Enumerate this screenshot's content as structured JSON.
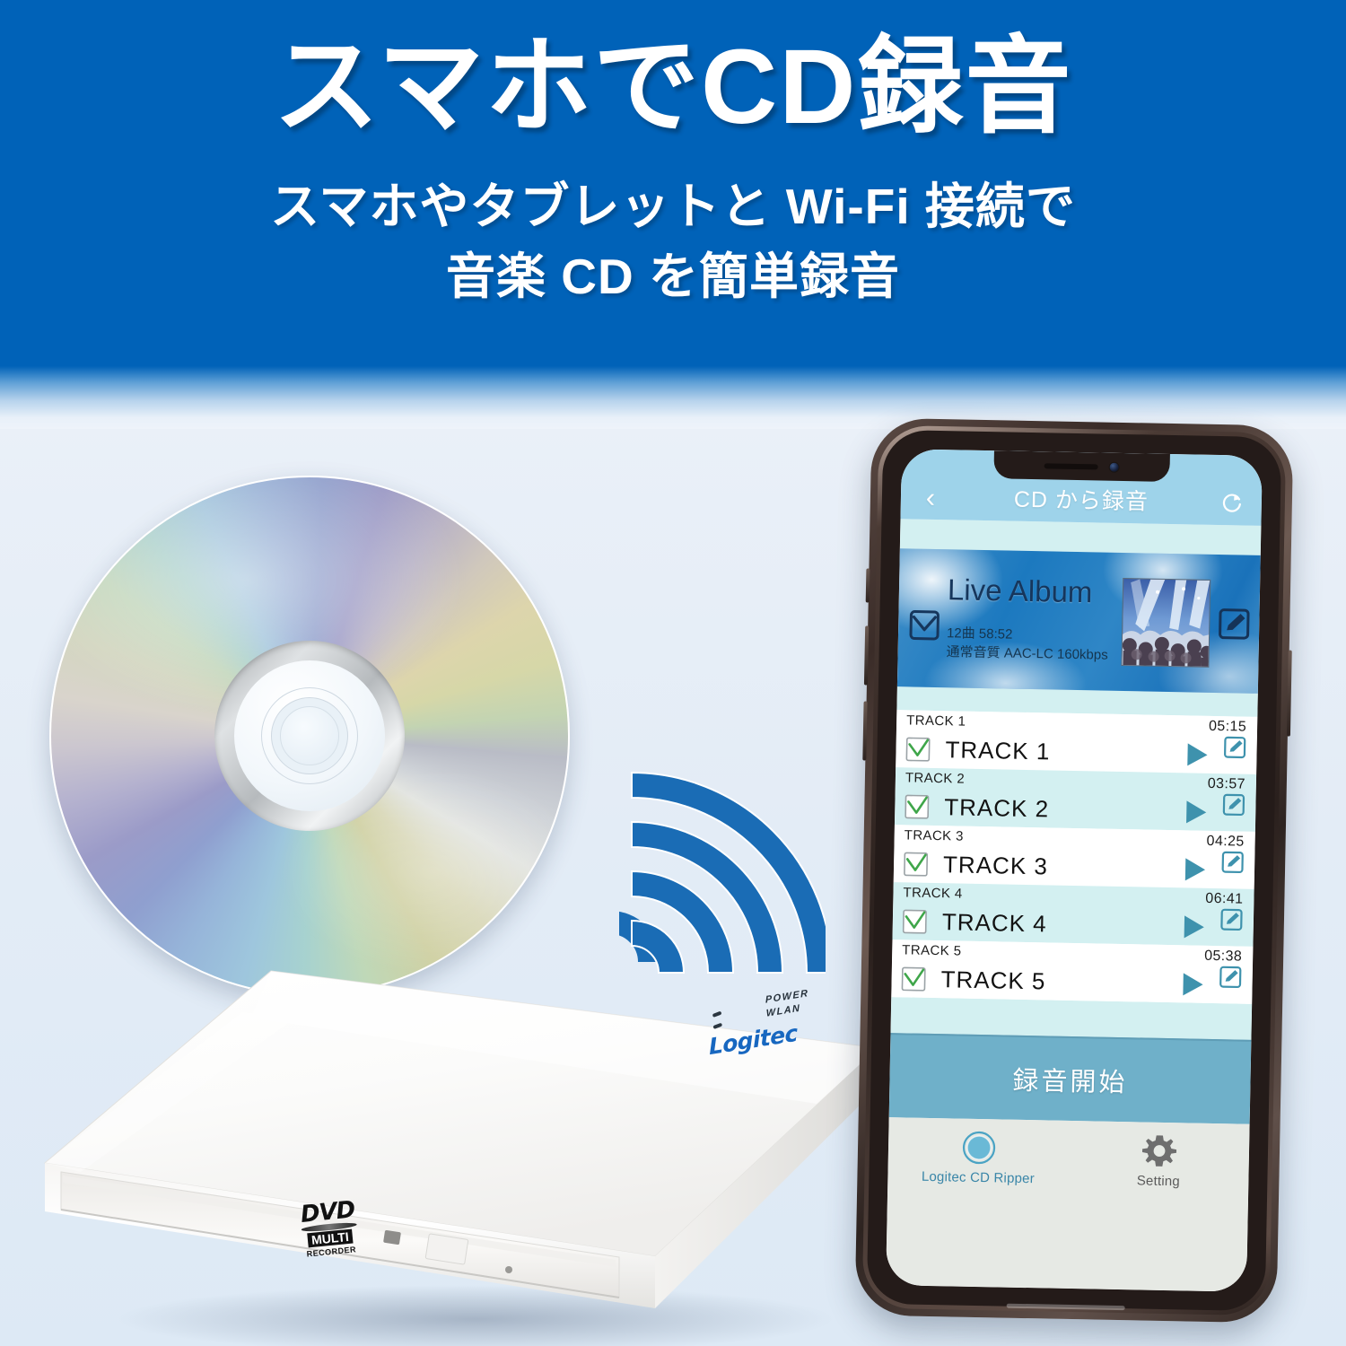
{
  "banner": {
    "title": "スマホでCD録音",
    "subtitle_line1": "スマホやタブレットと Wi-Fi 接続で",
    "subtitle_line2": "音楽 CD を簡単録音",
    "bg_color": "#0062b8",
    "text_color": "#ffffff"
  },
  "device": {
    "brand": "Logitec",
    "led_power": "POWER",
    "led_wlan": "WLAN",
    "dvd_logo_word": "DVD",
    "dvd_logo_multi": "MULTI",
    "dvd_logo_recorder": "RECORDER"
  },
  "phone": {
    "navbar": {
      "back_icon": "chevron-left-icon",
      "title": "CD から録音",
      "refresh_icon": "refresh-icon",
      "bg_color": "#9ed3ea"
    },
    "album": {
      "title": "Live Album",
      "tracks_duration": "12曲 58:52",
      "quality": "通常音質 AAC-LC 160kbps",
      "checked": true,
      "edit_icon": "edit-pencil-icon",
      "artwork_alt": "concert-artwork"
    },
    "tracks": [
      {
        "label": "TRACK 1",
        "time": "05:15",
        "name": "TRACK 1",
        "checked": true
      },
      {
        "label": "TRACK 2",
        "time": "03:57",
        "name": "TRACK 2",
        "checked": true
      },
      {
        "label": "TRACK 3",
        "time": "04:25",
        "name": "TRACK 3",
        "checked": true
      },
      {
        "label": "TRACK 4",
        "time": "06:41",
        "name": "TRACK 4",
        "checked": true
      },
      {
        "label": "TRACK 5",
        "time": "05:38",
        "name": "TRACK 5",
        "checked": true
      }
    ],
    "record_button": {
      "label": "録音開始",
      "bg_color": "#6fb0c9"
    },
    "tabbar": {
      "tabs": [
        {
          "label": "Logitec CD Ripper",
          "icon": "disc-circle-icon",
          "active": true
        },
        {
          "label": "Setting",
          "icon": "gear-icon",
          "active": false
        }
      ]
    }
  },
  "colors": {
    "brand_blue": "#0062b8",
    "nav_blue": "#9ed3ea",
    "row_tint": "#d3f0f1",
    "accent_teal": "#3e92ad",
    "check_green": "#3fa64a",
    "wifi_blue": "#1a6cb5"
  }
}
